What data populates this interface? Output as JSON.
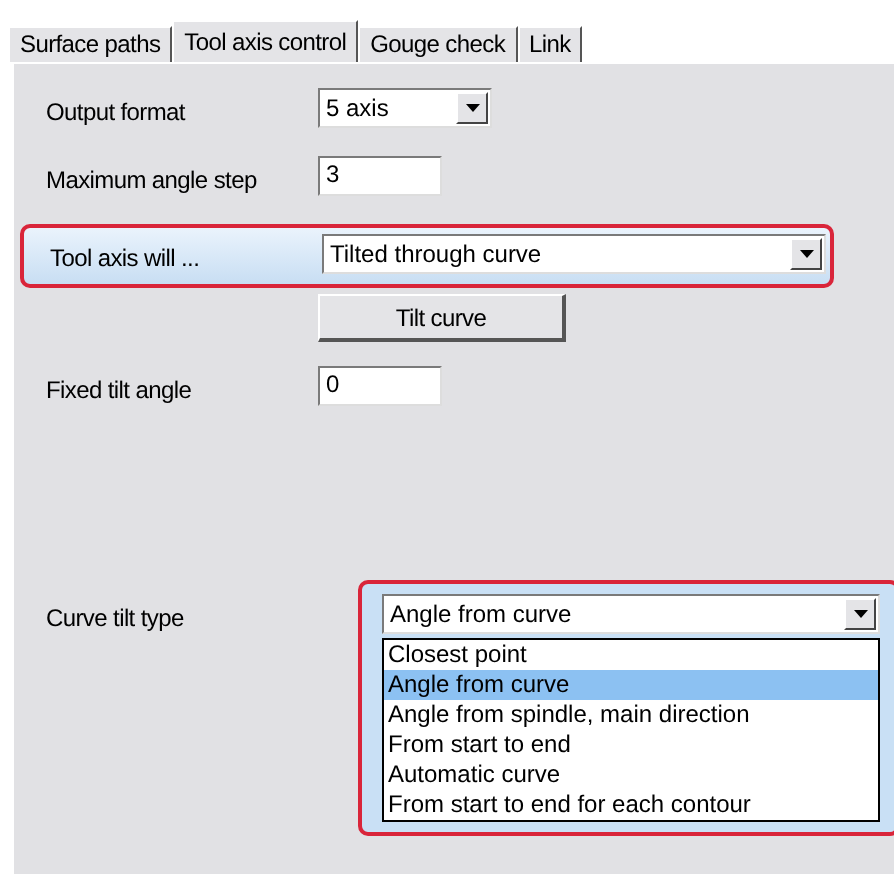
{
  "tabs": [
    {
      "label": "Surface paths",
      "selected": false
    },
    {
      "label": "Tool axis control",
      "selected": true
    },
    {
      "label": "Gouge check",
      "selected": false
    },
    {
      "label": "Link",
      "selected": false
    }
  ],
  "rows": [
    {
      "kind": "select",
      "label": "Output format",
      "value": "5 axis"
    },
    {
      "kind": "input",
      "label": "Maximum angle step",
      "value": "3"
    },
    {
      "kind": "select",
      "label": "Tool axis will ...",
      "value": "Tilted through curve",
      "highlighted": true
    },
    {
      "kind": "button",
      "value": "Tilt curve"
    },
    {
      "kind": "input",
      "label": "Fixed tilt angle",
      "value": "0"
    },
    {
      "kind": "select",
      "label": "Curve tilt type",
      "value": "Angle from curve",
      "highlighted": true,
      "options": [
        {
          "label": "Closest point",
          "selected": false
        },
        {
          "label": "Angle from curve",
          "selected": true
        },
        {
          "label": "Angle from spindle, main direction",
          "selected": false
        },
        {
          "label": "From start to end",
          "selected": false
        },
        {
          "label": "Automatic curve",
          "selected": false
        },
        {
          "label": "From start to end for each contour",
          "selected": false
        }
      ]
    }
  ]
}
